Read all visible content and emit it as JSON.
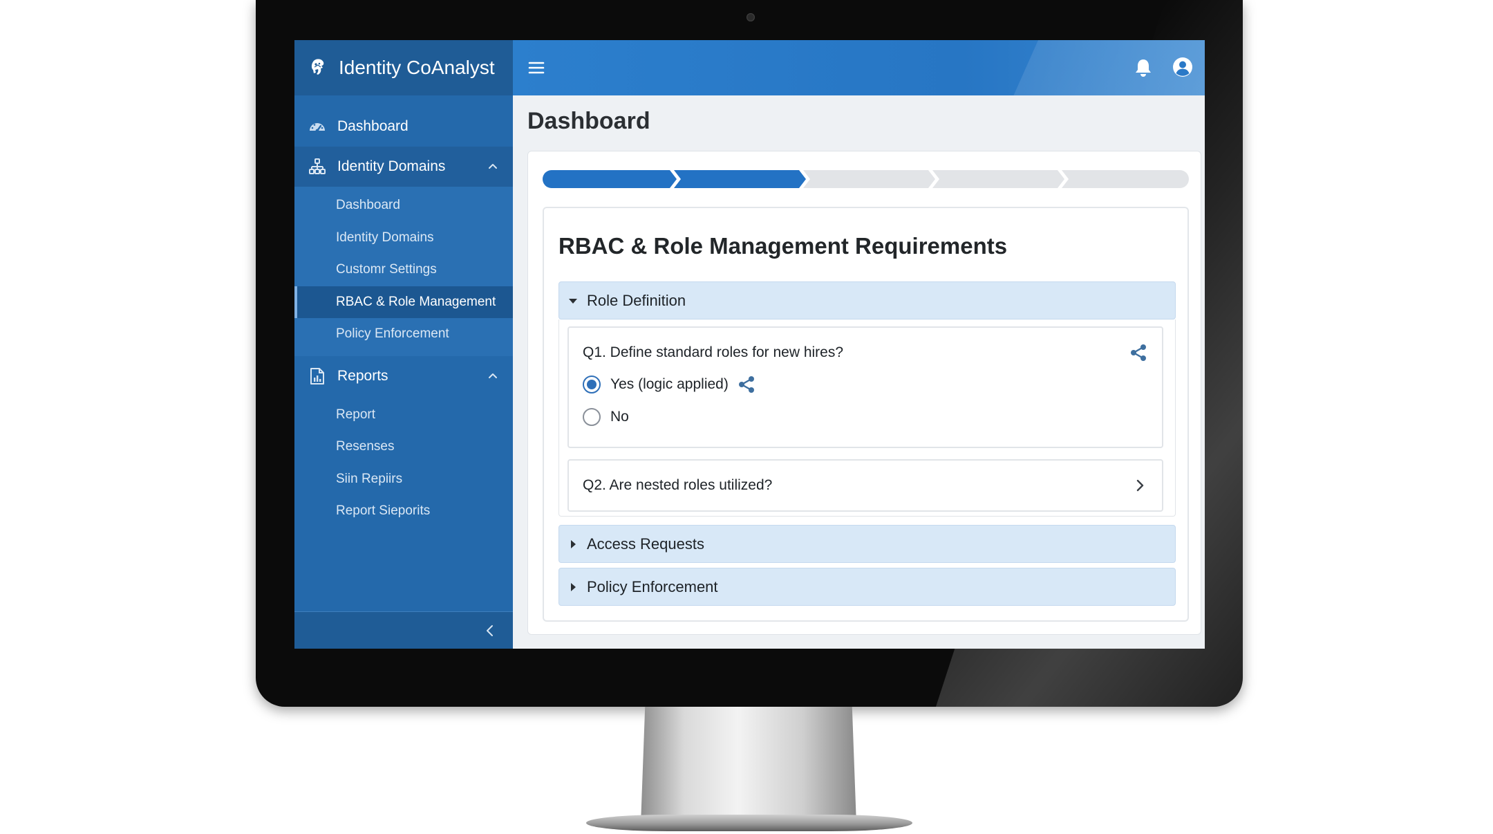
{
  "app": {
    "title": "Identity CoAnalyst"
  },
  "sidebar": {
    "items": [
      {
        "label": "Dashboard",
        "icon": "dashboard-gauge-icon"
      },
      {
        "label": "Identity Domains",
        "icon": "org-hierarchy-icon",
        "expanded": true,
        "children": [
          {
            "label": "Dashboard"
          },
          {
            "label": "Identity Domains"
          },
          {
            "label": "Customr Settings"
          },
          {
            "label": "RBAC & Role Management",
            "active": true
          },
          {
            "label": "Policy Enforcement"
          }
        ]
      },
      {
        "label": "Reports",
        "icon": "report-chart-icon",
        "expanded": true,
        "children": [
          {
            "label": "Report"
          },
          {
            "label": "Resenses"
          },
          {
            "label": "Siin Repiirs"
          },
          {
            "label": "Report Sieporits"
          }
        ]
      }
    ]
  },
  "header": {
    "page_title": "Dashboard"
  },
  "progress": {
    "total_steps": 5,
    "completed_steps": 2
  },
  "form": {
    "section_title": "RBAC & Role Management Requirements",
    "accordions": [
      {
        "label": "Role Definition",
        "expanded": true,
        "questions": [
          {
            "text": "Q1. Define standard roles for new hires?",
            "options": [
              {
                "label": "Yes (logic applied)",
                "selected": true
              },
              {
                "label": "No",
                "selected": false
              }
            ]
          },
          {
            "text": "Q2. Are nested roles utilized?"
          }
        ]
      },
      {
        "label": "Access Requests",
        "expanded": false
      },
      {
        "label": "Policy Enforcement",
        "expanded": false
      }
    ]
  },
  "colors": {
    "sidebar": "#2469ab",
    "topbar": "#2c7fcd",
    "accent": "#2e6fb8",
    "accordion_header": "#d8e8f7",
    "progress_done": "#2372c4",
    "progress_todo": "#e2e4e7"
  }
}
